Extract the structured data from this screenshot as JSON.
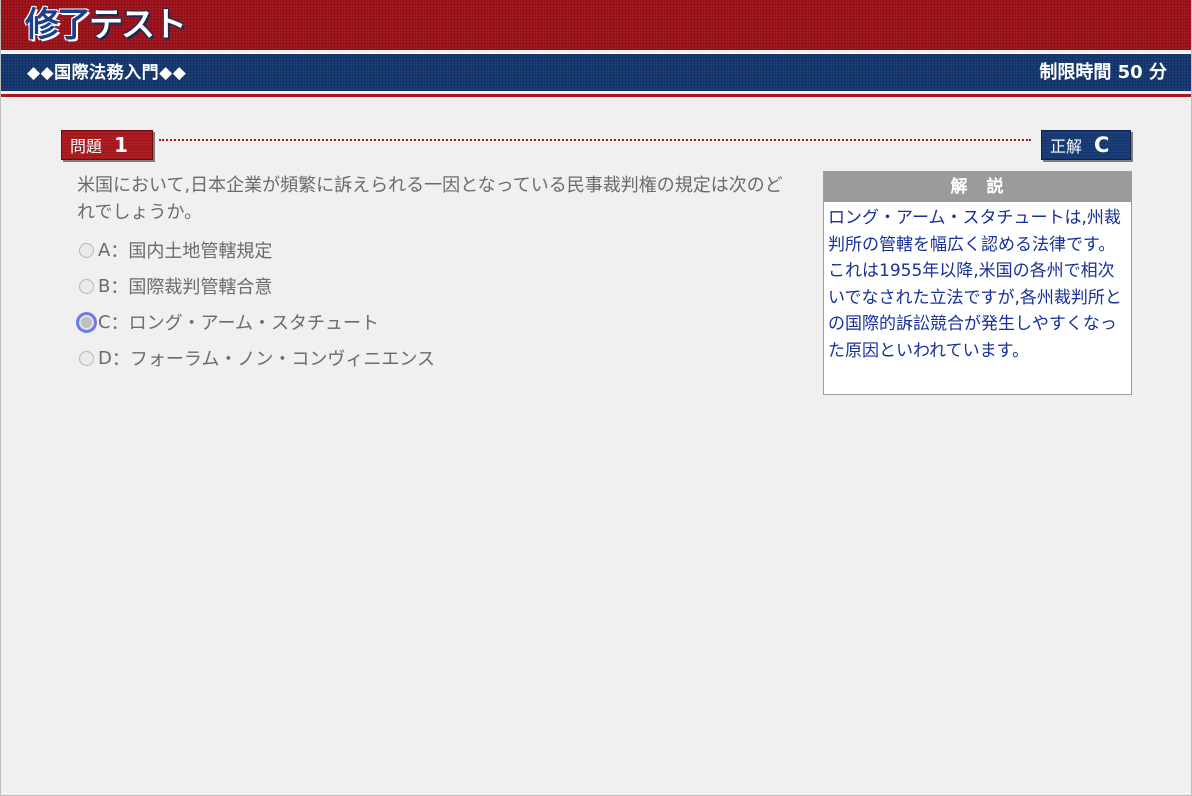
{
  "header": {
    "title_part1": "修了",
    "title_part2": "テスト",
    "course_name": "◆◆国際法務入門◆◆",
    "time_limit_label": "制限時間",
    "time_limit_value": "50",
    "time_limit_unit": "分"
  },
  "question": {
    "label": "問題",
    "number": "1",
    "text": "米国において,日本企業が頻繁に訴えられる一因となっている民事裁判権の規定は次のどれでしょうか。",
    "choices": [
      {
        "letter": "A",
        "text": "：国内土地管轄規定"
      },
      {
        "letter": "B",
        "text": "：国際裁判管轄合意"
      },
      {
        "letter": "C",
        "text": "：ロング・アーム・スタチュート"
      },
      {
        "letter": "D",
        "text": "：フォーラム・ノン・コンヴィニエンス"
      }
    ],
    "selected": "C"
  },
  "answer": {
    "label": "正解",
    "value": "C"
  },
  "explanation": {
    "title": "解　説",
    "body": "ロング・アーム・スタチュートは,州裁判所の管轄を幅広く認める法律です。これは1955年以降,米国の各州で相次いでなされた立法ですが,各州裁判所との国際的訴訟競合が発生しやすくなった原因といわれています。"
  },
  "colors": {
    "header_red": "#a8171f",
    "header_navy": "#1a3e7a",
    "explanation_text": "#17309a",
    "selected_radio_ring": "#6f7ae8"
  }
}
